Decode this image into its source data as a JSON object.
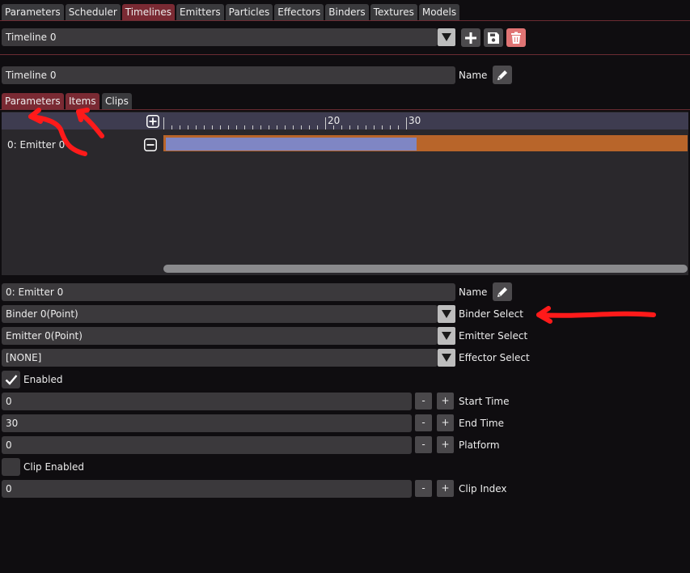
{
  "tabs": [
    {
      "label": "Parameters",
      "active": false
    },
    {
      "label": "Scheduler",
      "active": false
    },
    {
      "label": "Timelines",
      "active": true
    },
    {
      "label": "Emitters",
      "active": false
    },
    {
      "label": "Particles",
      "active": false
    },
    {
      "label": "Effectors",
      "active": false
    },
    {
      "label": "Binders",
      "active": false
    },
    {
      "label": "Textures",
      "active": false
    },
    {
      "label": "Models",
      "active": false
    }
  ],
  "timeline_select": {
    "value": "Timeline 0"
  },
  "timeline_name": {
    "value": "Timeline 0",
    "label": "Name"
  },
  "sub_tabs": [
    {
      "label": "Parameters",
      "active": true
    },
    {
      "label": "Items",
      "active": true
    },
    {
      "label": "Clips",
      "active": false
    }
  ],
  "ruler": {
    "ticks": [
      "20",
      "30"
    ]
  },
  "track": {
    "label": "0: Emitter 0",
    "start": 0,
    "end": 30
  },
  "item": {
    "name": {
      "value": "0: Emitter 0",
      "label": "Name"
    },
    "binder": {
      "value": "Binder 0(Point)",
      "label": "Binder Select"
    },
    "emitter": {
      "value": "Emitter 0(Point)",
      "label": "Emitter Select"
    },
    "effector": {
      "value": "[NONE]",
      "label": "Effector Select"
    },
    "enabled": {
      "label": "Enabled",
      "checked": true
    },
    "start_time": {
      "value": "0",
      "label": "Start Time"
    },
    "end_time": {
      "value": "30",
      "label": "End Time"
    },
    "platform": {
      "value": "0",
      "label": "Platform"
    },
    "clip_enabled": {
      "label": "Clip Enabled",
      "checked": false
    },
    "clip_index": {
      "value": "0",
      "label": "Clip Index"
    }
  },
  "steppers": {
    "minus": "-",
    "plus": "+"
  },
  "colors": {
    "active_tab": "#7a2a33",
    "track_bar": "#b8652a",
    "item_bar": "#7f86c4",
    "delete_button": "#e07474",
    "annotation": "#ff1a1a"
  }
}
